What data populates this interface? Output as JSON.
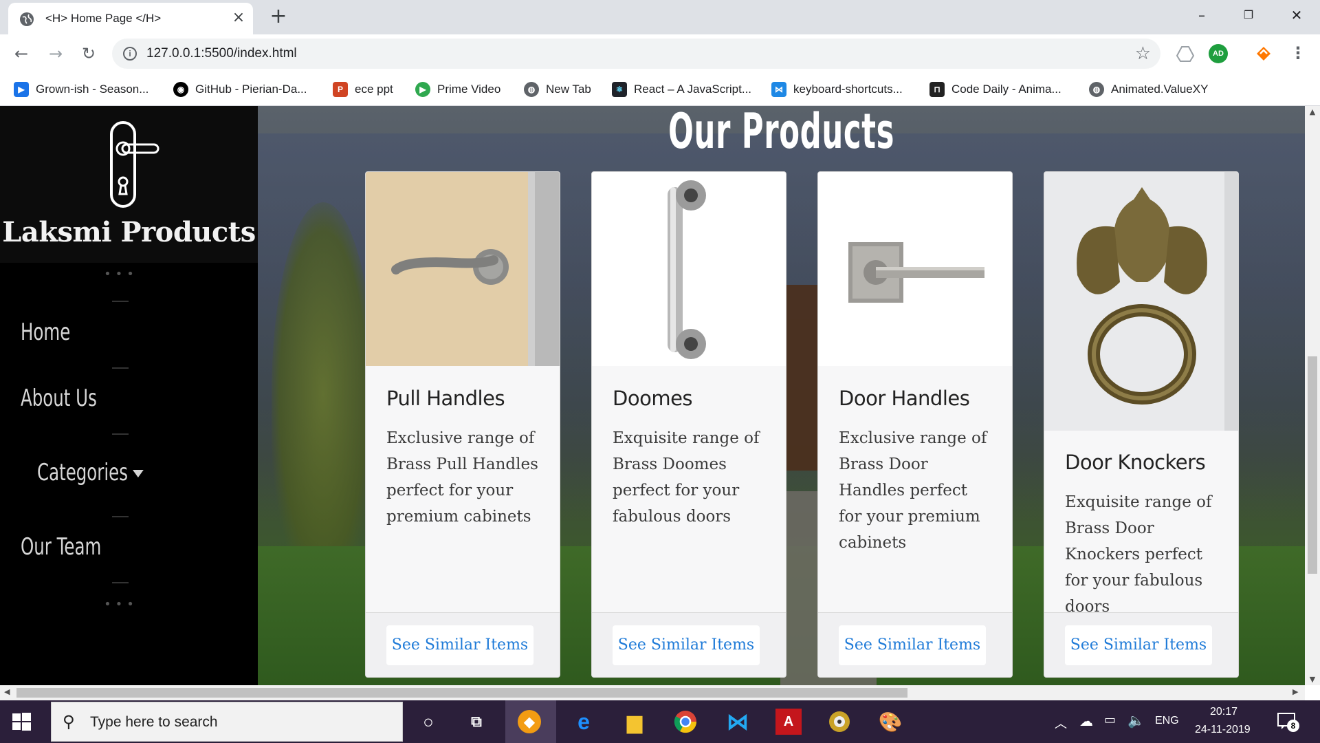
{
  "browser": {
    "tab_title": "<H> Home Page </H>",
    "url": "127.0.0.1:5500/index.html",
    "bookmarks": [
      {
        "label": "Grown-ish - Season...",
        "icon": "play-icon",
        "color": "#1a73e8"
      },
      {
        "label": "GitHub - Pierian-Da...",
        "icon": "github-icon",
        "color": "#000000"
      },
      {
        "label": "ece ppt",
        "icon": "powerpoint-icon",
        "color": "#d04423"
      },
      {
        "label": "Prime Video",
        "icon": "prime-video-icon",
        "color": "#2fa84f"
      },
      {
        "label": "New Tab",
        "icon": "globe-icon",
        "color": "#5f6368"
      },
      {
        "label": "React – A JavaScript...",
        "icon": "react-icon",
        "color": "#20232a"
      },
      {
        "label": "keyboard-shortcuts...",
        "icon": "vscode-icon",
        "color": "#1e88e5"
      },
      {
        "label": "Code Daily - Anima...",
        "icon": "car-icon",
        "color": "#222222"
      },
      {
        "label": "Animated.ValueXY",
        "icon": "globe-icon",
        "color": "#5f6368"
      }
    ],
    "extension_badge": "AD"
  },
  "sidebar": {
    "brand": "Laksmi Products",
    "nav": [
      {
        "label": "Home"
      },
      {
        "label": "About Us"
      },
      {
        "label": "Categories"
      },
      {
        "label": "Our Team"
      }
    ]
  },
  "main": {
    "title": "Our Products",
    "cards": [
      {
        "title": "Pull Handles",
        "text": "Exclusive range of Brass Pull Handles perfect for your premium cabinets",
        "button": "See Similar Items"
      },
      {
        "title": "Doomes",
        "text": "Exquisite range of Brass Doomes perfect for your fabulous doors",
        "button": "See Similar Items"
      },
      {
        "title": "Door Handles",
        "text": "Exclusive range of Brass Door Handles perfect for your premium cabinets",
        "button": "See Similar Items"
      },
      {
        "title": "Door Knockers",
        "text": "Exquisite range of Brass Door Knockers perfect for your fabulous doors",
        "button": "See Similar Items"
      }
    ]
  },
  "taskbar": {
    "search_placeholder": "Type here to search",
    "language": "ENG",
    "time": "20:17",
    "date": "24-11-2019",
    "notification_count": "8"
  },
  "colors": {
    "link_blue": "#1f7bd8",
    "sidebar_bg": "#000000",
    "taskbar_bg": "#2b1f3a"
  }
}
